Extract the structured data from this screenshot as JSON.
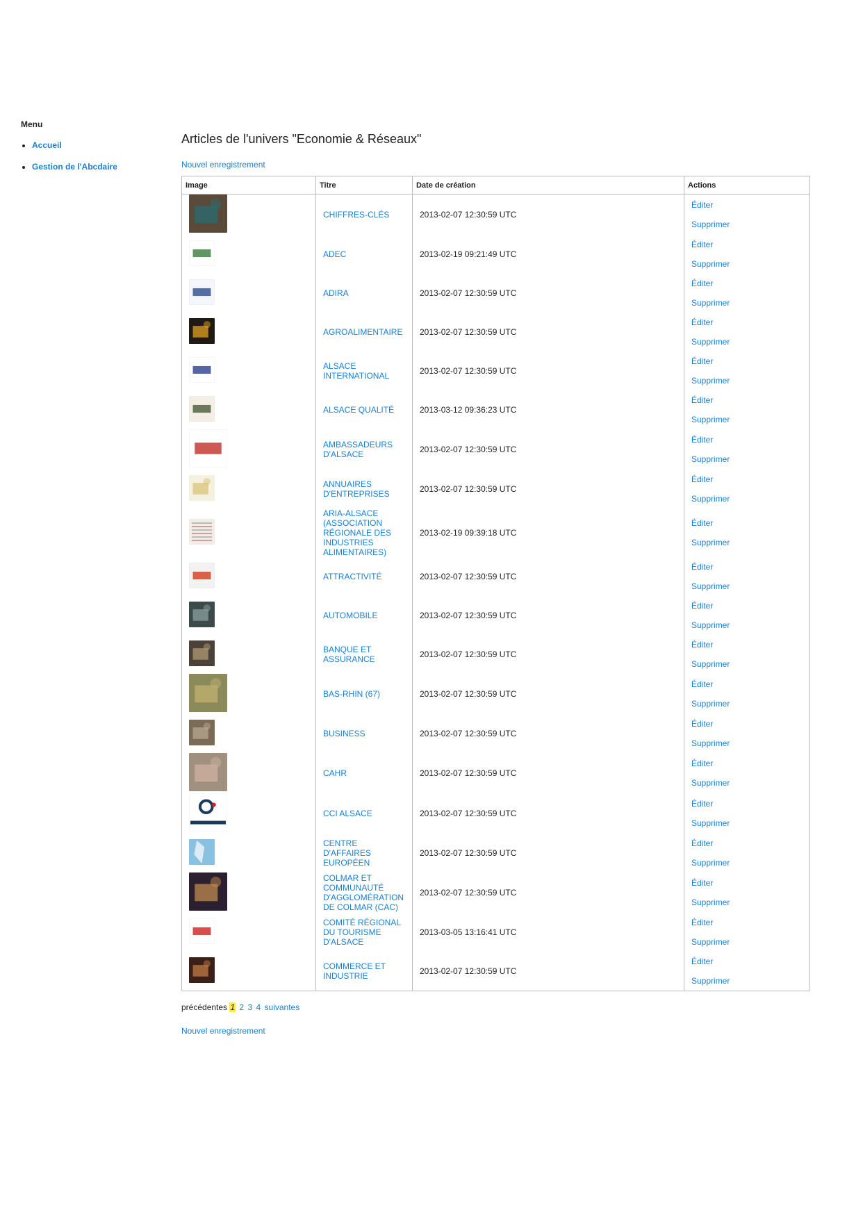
{
  "sidebar": {
    "title": "Menu",
    "items": [
      {
        "label": "Accueil"
      },
      {
        "label": "Gestion de l'Abcdaire"
      }
    ]
  },
  "main": {
    "title": "Articles de l'univers \"Economie & Réseaux\"",
    "new_link": "Nouvel enregistrement",
    "columns": [
      "Image",
      "Titre",
      "Date de création",
      "Actions"
    ],
    "edit_label": "Éditer",
    "delete_label": "Supprimer",
    "rows": [
      {
        "title": "CHIFFRES-CLÉS",
        "date": "2013-02-07 12:30:59 UTC",
        "thumb": "photo",
        "color": "#5a4a3a",
        "color2": "#2a6b72",
        "size": "large"
      },
      {
        "title": "ADEC",
        "date": "2013-02-19 09:21:49 UTC",
        "thumb": "logo",
        "color": "#ffffff",
        "color2": "#3a7a3a",
        "size": "small"
      },
      {
        "title": "ADIRA",
        "date": "2013-02-07 12:30:59 UTC",
        "thumb": "logo",
        "color": "#f4f6fa",
        "color2": "#2a4d8f",
        "size": "small"
      },
      {
        "title": "AGROALIMENTAIRE",
        "date": "2013-02-07 12:30:59 UTC",
        "thumb": "photo",
        "color": "#1f1a14",
        "color2": "#e0a020",
        "size": "small"
      },
      {
        "title": "ALSACE INTERNATIONAL",
        "date": "2013-02-07 12:30:59 UTC",
        "thumb": "logo",
        "color": "#ffffff",
        "color2": "#2a3f8f",
        "size": "small"
      },
      {
        "title": "ALSACE QUALITÉ",
        "date": "2013-03-12 09:36:23 UTC",
        "thumb": "logo",
        "color": "#f3efe4",
        "color2": "#4a5a3a",
        "size": "small"
      },
      {
        "title": "AMBASSADEURS D'ALSACE",
        "date": "2013-02-07 12:30:59 UTC",
        "thumb": "logo",
        "color": "#ffffff",
        "color2": "#c0302a",
        "size": "large"
      },
      {
        "title": "ANNUAIRES D'ENTREPRISES",
        "date": "2013-02-07 12:30:59 UTC",
        "thumb": "photo",
        "color": "#f5f1e0",
        "color2": "#d8c47a",
        "size": "small"
      },
      {
        "title": "ARIA-ALSACE (ASSOCIATION RÉGIONALE DES INDUSTRIES ALIMENTAIRES)",
        "date": "2013-02-19 09:39:18 UTC",
        "thumb": "doc",
        "color": "#f2ece6",
        "color2": "#b07070",
        "size": "small"
      },
      {
        "title": "ATTRACTIVITÉ",
        "date": "2013-02-07 12:30:59 UTC",
        "thumb": "logo",
        "color": "#f2f2f2",
        "color2": "#d93a1a",
        "size": "small"
      },
      {
        "title": "AUTOMOBILE",
        "date": "2013-02-07 12:30:59 UTC",
        "thumb": "photo",
        "color": "#3c4a4a",
        "color2": "#8aa0a0",
        "size": "small"
      },
      {
        "title": "BANQUE ET ASSURANCE",
        "date": "2013-02-07 12:30:59 UTC",
        "thumb": "photo",
        "color": "#4a4238",
        "color2": "#b09a72",
        "size": "small"
      },
      {
        "title": "BAS-RHIN (67)",
        "date": "2013-02-07 12:30:59 UTC",
        "thumb": "photo",
        "color": "#8a8a5a",
        "color2": "#c0b070",
        "size": "large"
      },
      {
        "title": "BUSINESS",
        "date": "2013-02-07 12:30:59 UTC",
        "thumb": "photo",
        "color": "#7a6a58",
        "color2": "#b8a890",
        "size": "small"
      },
      {
        "title": "CAHR",
        "date": "2013-02-07 12:30:59 UTC",
        "thumb": "photo",
        "color": "#a09080",
        "color2": "#d0b0a0",
        "size": "large"
      },
      {
        "title": "CCI ALSACE",
        "date": "2013-02-07 12:30:59 UTC",
        "thumb": "cci",
        "color": "#ffffff",
        "color2": "#1a3a5a",
        "size": "large"
      },
      {
        "title": "CENTRE D'AFFAIRES EUROPÉEN",
        "date": "2013-02-07 12:30:59 UTC",
        "thumb": "map",
        "color": "#8ac0e0",
        "color2": "#ffffff",
        "size": "small"
      },
      {
        "title": "COLMAR ET COMMUNAUTÉ D'AGGLOMÉRATION DE COLMAR (CAC)",
        "date": "2013-02-07 12:30:59 UTC",
        "thumb": "photo",
        "color": "#2a2030",
        "color2": "#c08a50",
        "size": "large"
      },
      {
        "title": "COMITÉ RÉGIONAL DU TOURISME D'ALSACE",
        "date": "2013-03-05 13:16:41 UTC",
        "thumb": "logo",
        "color": "#ffffff",
        "color2": "#d02020",
        "size": "small"
      },
      {
        "title": "COMMERCE ET INDUSTRIE",
        "date": "2013-02-07 12:30:59 UTC",
        "thumb": "photo",
        "color": "#3a2018",
        "color2": "#c07a40",
        "size": "small"
      }
    ]
  },
  "pagination": {
    "prev": "précédentes",
    "current": "1",
    "pages": [
      "2",
      "3",
      "4"
    ],
    "next": "suivantes"
  }
}
